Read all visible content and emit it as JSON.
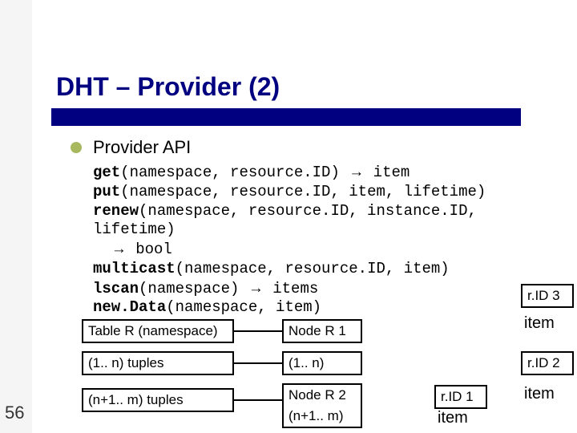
{
  "title": "DHT – Provider (2)",
  "subtitle": "Provider API",
  "api": {
    "line1": "get(namespace, resource.ID) → item",
    "line2": "put(namespace, resource.ID, item, lifetime)",
    "line3": "renew(namespace, resource.ID, instance.ID, lifetime) → bool",
    "line4": "multicast(namespace, resource.ID, item)",
    "line5": "lscan(namespace) → items",
    "line6": "new.Data(namespace, item)",
    "kw": {
      "get": "get",
      "put": "put",
      "renew": "renew",
      "multicast": "multicast",
      "lscan": "lscan",
      "newData": "new.Data"
    },
    "tail": {
      "get": "(namespace, resource.ID) ",
      "get_ret": " item",
      "put": "(namespace, resource.ID, item, lifetime)",
      "renew": "(namespace, resource.ID, instance.ID, lifetime) ",
      "renew_arrow": "→",
      "renew_ret": " bool",
      "multicast": "(namespace, resource.ID, item)",
      "lscan": "(namespace) ",
      "lscan_ret": " items",
      "newData": "(namespace, item)"
    },
    "arrow": "→",
    "indent": "  "
  },
  "diagram": {
    "tableR": "Table R (namespace)",
    "tuples1": "(1.. n) tuples",
    "tuples2": "(n+1.. m) tuples",
    "nodeR1": "Node R 1",
    "range1": "(1.. n)",
    "nodeR2": "Node R 2",
    "range2": "(n+1.. m)",
    "rid1": "r.ID 1",
    "rid2": "r.ID 2",
    "rid3": "r.ID 3",
    "item": "item"
  },
  "slide_number": "56"
}
